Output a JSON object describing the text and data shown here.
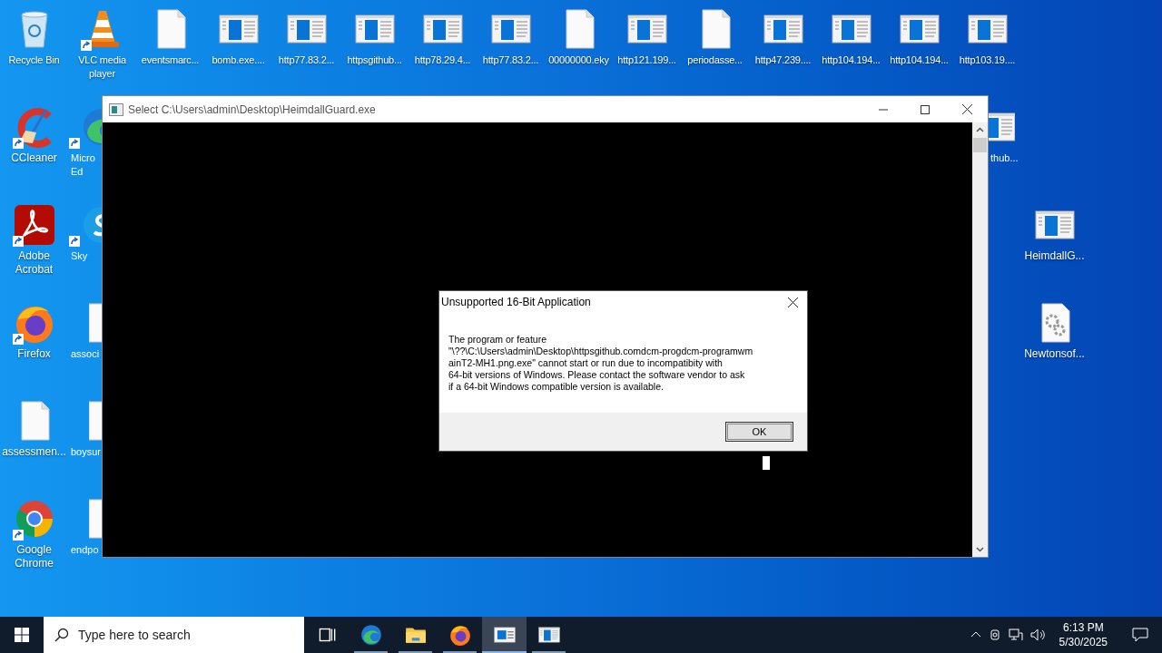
{
  "desktop": {
    "top_row": [
      {
        "label": "Recycle Bin",
        "kind": "recycle"
      },
      {
        "label": "VLC media player",
        "kind": "vlc"
      },
      {
        "label": "eventsmarc...",
        "kind": "file"
      },
      {
        "label": "bomb.exe....",
        "kind": "app"
      },
      {
        "label": "http77.83.2...",
        "kind": "app"
      },
      {
        "label": "httpsgithub...",
        "kind": "app"
      },
      {
        "label": "http78.29.4...",
        "kind": "app"
      },
      {
        "label": "http77.83.2...",
        "kind": "app"
      },
      {
        "label": "00000000.eky",
        "kind": "file"
      },
      {
        "label": "http121.199...",
        "kind": "app"
      },
      {
        "label": "periodasse...",
        "kind": "file"
      },
      {
        "label": "http47.239....",
        "kind": "app"
      },
      {
        "label": "http104.194...",
        "kind": "app"
      },
      {
        "label": "http104.194...",
        "kind": "app"
      },
      {
        "label": "http103.19....",
        "kind": "app"
      }
    ],
    "left_column": [
      {
        "label": "CCleaner",
        "kind": "ccleaner"
      },
      {
        "label": "Adobe Acrobat",
        "kind": "acrobat"
      },
      {
        "label": "Firefox",
        "kind": "firefox"
      },
      {
        "label": "assessmen...",
        "kind": "file"
      },
      {
        "label": "Google Chrome",
        "kind": "chrome"
      }
    ],
    "second_column": [
      {
        "label": "Micro\nEd",
        "kind": "edge"
      },
      {
        "label": "Sky",
        "kind": "skype"
      },
      {
        "label": "associ",
        "kind": "file"
      },
      {
        "label": "boysur",
        "kind": "file"
      },
      {
        "label": "endpo",
        "kind": "file"
      }
    ],
    "right_column": [
      {
        "label": "thub...",
        "kind": "app"
      },
      {
        "label": "HeimdallG...",
        "kind": "app"
      },
      {
        "label": "Newtonsof...",
        "kind": "gearfile"
      }
    ]
  },
  "console_window": {
    "title": "Select C:\\Users\\admin\\Desktop\\HeimdallGuard.exe"
  },
  "dialog": {
    "title": "Unsupported 16-Bit Application",
    "message": "The program or feature\n\"\\??\\C:\\Users\\admin\\Desktop\\httpsgithub.comdcm-progdcm-programwm\nainT2-MH1.png.exe\" cannot start or run due to incompatibity with\n64-bit versions of Windows. Please contact the software vendor to ask\nif a 64-bit Windows compatible version is available.",
    "button": "OK"
  },
  "taskbar": {
    "search_placeholder": "Type here to search",
    "apps": [
      {
        "kind": "taskview",
        "selected": false
      },
      {
        "kind": "edge",
        "selected": false
      },
      {
        "kind": "explorer",
        "selected": false
      },
      {
        "kind": "firefox",
        "selected": false
      },
      {
        "kind": "console",
        "selected": true
      },
      {
        "kind": "app",
        "selected": false
      }
    ],
    "time": "6:13 PM",
    "date": "5/30/2025"
  }
}
